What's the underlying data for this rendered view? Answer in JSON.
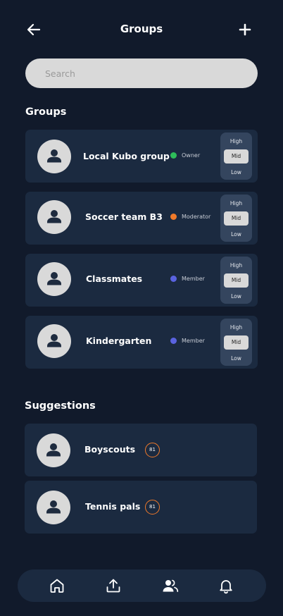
{
  "header": {
    "title": "Groups"
  },
  "search": {
    "placeholder": "Search"
  },
  "groups_section": {
    "title": "Groups",
    "items": [
      {
        "name": "Local Kubo group",
        "role": "Owner",
        "role_color": "#2ebd5a",
        "priority": {
          "options": [
            "High",
            "Mid",
            "Low"
          ],
          "selected": "Mid"
        }
      },
      {
        "name": "Soccer team B3",
        "role": "Moderator",
        "role_color": "#f07a2a",
        "priority": {
          "options": [
            "High",
            "Mid",
            "Low"
          ],
          "selected": "Mid"
        }
      },
      {
        "name": "Classmates",
        "role": "Member",
        "role_color": "#5a63e0",
        "priority": {
          "options": [
            "High",
            "Mid",
            "Low"
          ],
          "selected": "Mid"
        }
      },
      {
        "name": "Kindergarten",
        "role": "Member",
        "role_color": "#5a63e0",
        "priority": {
          "options": [
            "High",
            "Mid",
            "Low"
          ],
          "selected": "Mid"
        }
      }
    ]
  },
  "suggestions_section": {
    "title": "Suggestions",
    "items": [
      {
        "name": "Boyscouts",
        "badge": "81"
      },
      {
        "name": "Tennis pals",
        "badge": "81"
      }
    ]
  },
  "navbar": {
    "items": [
      "home-icon",
      "upload-icon",
      "groups-icon",
      "bell-icon"
    ]
  },
  "colors": {
    "background": "#111a2b",
    "card": "#1b2a40",
    "priority_bg": "#34455e",
    "accent_orange": "#f07a2a"
  }
}
